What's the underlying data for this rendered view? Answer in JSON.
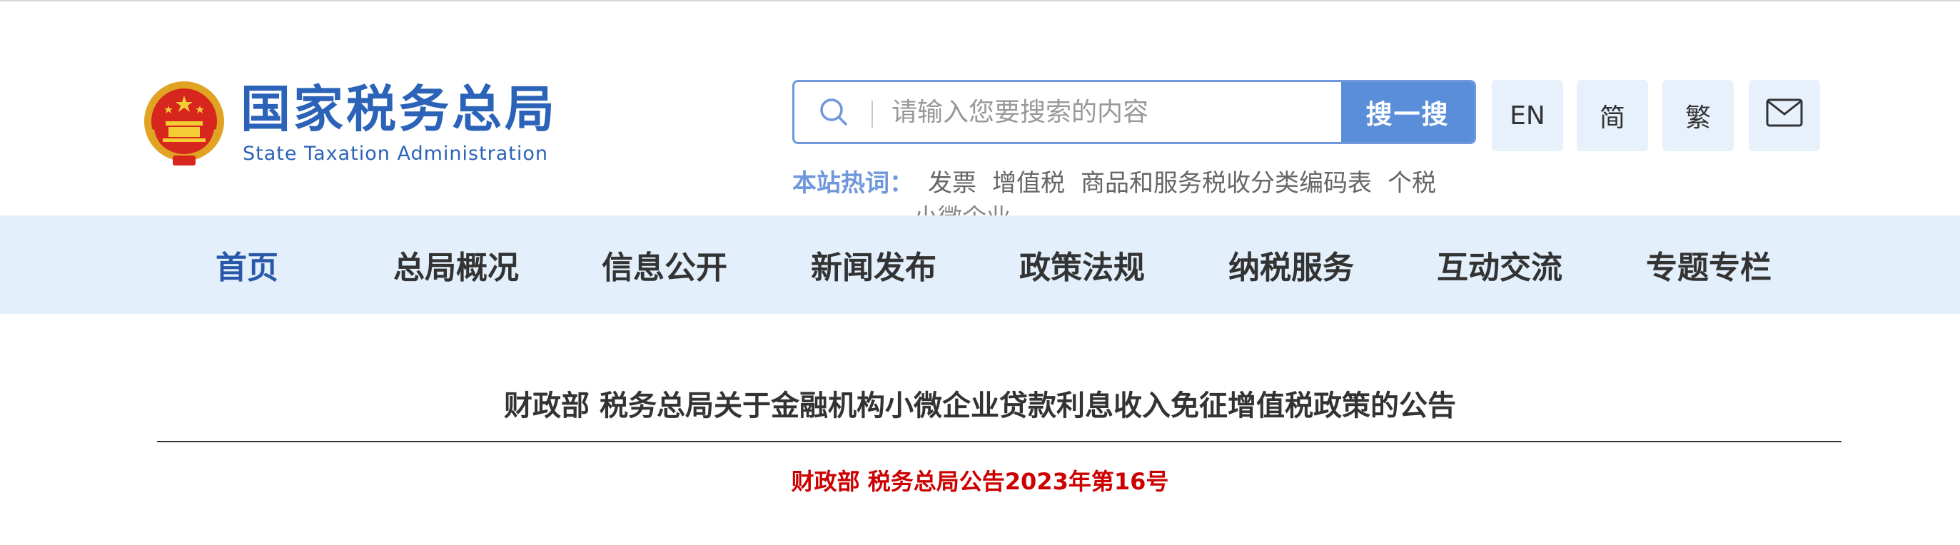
{
  "header": {
    "site_name": "国家税务总局",
    "site_name_en": "State Taxation Administration"
  },
  "search": {
    "placeholder": "请输入您要搜索的内容",
    "button_label": "搜一搜"
  },
  "toolbar": {
    "lang_en": "EN",
    "simplified": "简",
    "traditional": "繁",
    "mail_icon": "mail-icon"
  },
  "hot_words": {
    "label": "本站热词：",
    "items": [
      "发票",
      "增值税",
      "商品和服务税收分类编码表",
      "个税"
    ],
    "clipped_next_row": "小微企业"
  },
  "nav": {
    "items": [
      "首页",
      "总局概况",
      "信息公开",
      "新闻发布",
      "政策法规",
      "纳税服务",
      "互动交流",
      "专题专栏"
    ],
    "active_index": 0
  },
  "article": {
    "title": "财政部 税务总局关于金融机构小微企业贷款利息收入免征增值税政策的公告",
    "doc_number": "财政部 税务总局公告2023年第16号"
  },
  "colors": {
    "brand_blue": "#2b63b8",
    "search_border": "#6f97dc",
    "search_button": "#5b8ed8",
    "nav_bg": "#e3effb",
    "doc_number_red": "#cc0000"
  }
}
